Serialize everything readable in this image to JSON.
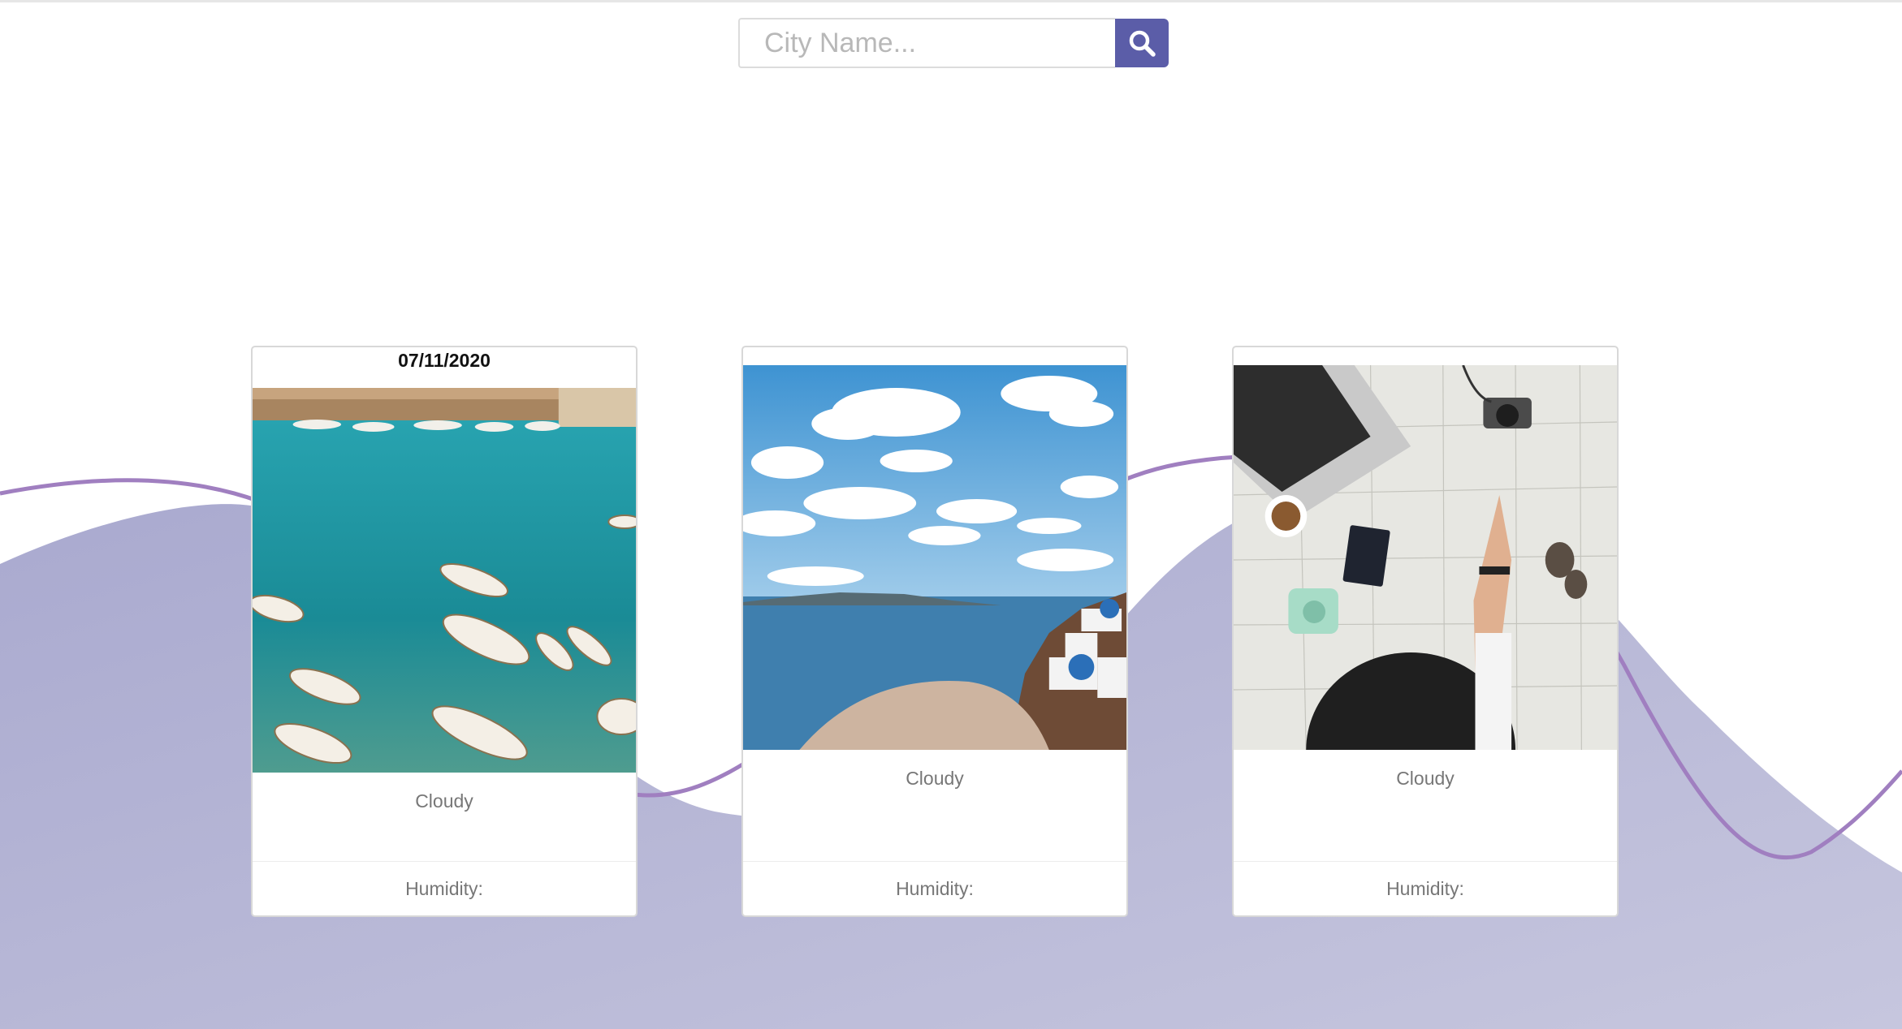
{
  "search": {
    "placeholder": "City Name...",
    "value": "",
    "button_icon": "search-icon"
  },
  "theme": {
    "accent": "#5b5da8",
    "wave_fill": "#b3b3d3",
    "wave_line": "#a07fc0"
  },
  "forecast_cards": [
    {
      "date": "07/11/2020",
      "condition": "Cloudy",
      "humidity_label": "Humidity:",
      "photo": "harbor-boats-photo"
    },
    {
      "date": "",
      "condition": "Cloudy",
      "humidity_label": "Humidity:",
      "photo": "coastal-village-photo"
    },
    {
      "date": "",
      "condition": "Cloudy",
      "humidity_label": "Humidity:",
      "photo": "travel-map-flatlay-photo"
    }
  ]
}
